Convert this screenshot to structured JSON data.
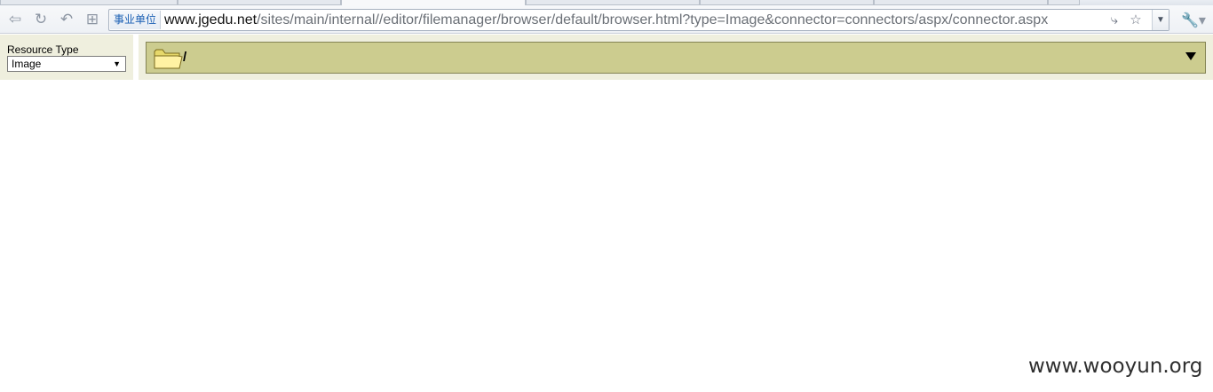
{
  "browser": {
    "site_label": "事业单位",
    "url_host": "www.jgedu.net",
    "url_path": "/sites/main/internal//editor/filemanager/browser/default/browser.html?type=Image&connector=connectors/aspx/connector.aspx",
    "icons": [
      "back-arrow-icon",
      "reload-icon",
      "undo-icon",
      "grid-icon",
      "lightning-icon",
      "star-icon",
      "chevron-down-icon",
      "wrench-icon"
    ]
  },
  "file_browser": {
    "resource_type_label": "Resource Type",
    "resource_type_value": "Image",
    "current_folder": "/"
  },
  "watermark": "www.wooyun.org",
  "colors": {
    "panel_bg": "#efefde",
    "folder_bar_bg": "#cccc8f",
    "folder_bar_border": "#848455"
  }
}
